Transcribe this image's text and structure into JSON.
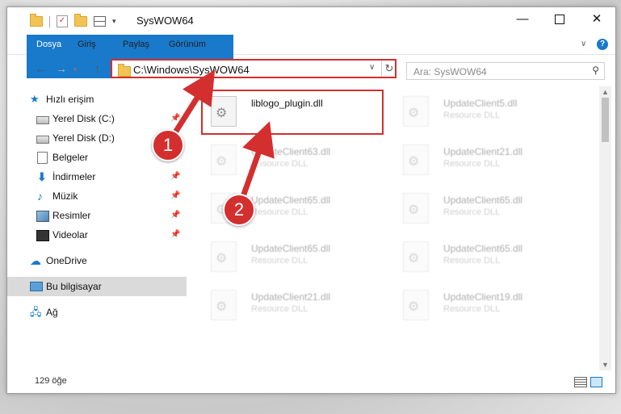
{
  "window": {
    "title": "SysWOW64",
    "min_glyph": "—",
    "close_glyph": "✕"
  },
  "ribbon": {
    "tabs": [
      {
        "label": "Dosya"
      },
      {
        "label": "Giriş"
      },
      {
        "label": "Paylaş"
      },
      {
        "label": "Görünüm"
      }
    ],
    "help_glyph": "?"
  },
  "address_bar": {
    "path": "C:\\Windows\\SysWOW64",
    "refresh_glyph": "↻"
  },
  "search": {
    "placeholder": "Ara: SysWOW64"
  },
  "sidebar": {
    "items": [
      {
        "label": "Hızlı erişim",
        "icon": "star-icon"
      },
      {
        "label": "Yerel Disk (C:)",
        "icon": "drive-icon",
        "pinned": true
      },
      {
        "label": "Yerel Disk (D:)",
        "icon": "drive-icon"
      },
      {
        "label": "Belgeler",
        "icon": "documents-icon",
        "pinned": true
      },
      {
        "label": "İndirmeler",
        "icon": "downloads-icon",
        "pinned": true
      },
      {
        "label": "Müzik",
        "icon": "music-icon",
        "pinned": true
      },
      {
        "label": "Resimler",
        "icon": "pictures-icon",
        "pinned": true
      },
      {
        "label": "Videolar",
        "icon": "videos-icon",
        "pinned": true
      },
      {
        "label": "OneDrive",
        "icon": "cloud-icon"
      },
      {
        "label": "Bu bilgisayar",
        "icon": "computer-icon",
        "selected": true
      },
      {
        "label": "Ağ",
        "icon": "network-icon"
      }
    ],
    "pin_glyph": "📌"
  },
  "files": [
    {
      "name": "liblogo_plugin.dll",
      "type": "",
      "highlighted": true
    },
    {
      "name": "UpdateClient5.dll",
      "type": "Resource DLL"
    },
    {
      "name": "UpdateClient63.dll",
      "type": "Resource DLL"
    },
    {
      "name": "UpdateClient21.dll",
      "type": "Resource DLL"
    },
    {
      "name": "UpdateClient65.dll",
      "type": "Resource DLL"
    },
    {
      "name": "UpdateClient65.dll",
      "type": "Resource DLL"
    },
    {
      "name": "UpdateClient65.dll",
      "type": "Resource DLL"
    },
    {
      "name": "UpdateClient65.dll",
      "type": "Resource DLL"
    },
    {
      "name": "UpdateClient21.dll",
      "type": "Resource DLL"
    },
    {
      "name": "UpdateClient19.dll",
      "type": "Resource DLL"
    }
  ],
  "status": {
    "item_count": "129 öğe"
  },
  "callouts": {
    "step1": "1",
    "step2": "2"
  },
  "colors": {
    "accent": "#1979ca",
    "highlight": "#d32f2f"
  }
}
